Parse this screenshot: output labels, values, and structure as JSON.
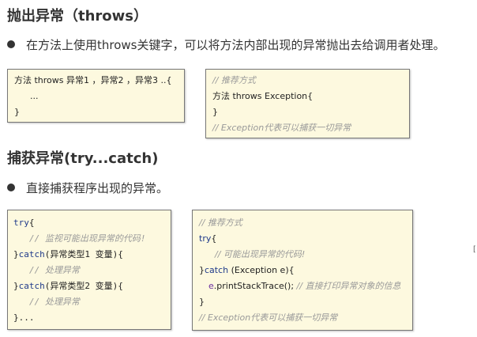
{
  "section1": {
    "title": "抛出异常（throws）",
    "bullet": "在方法上使用throws关键字，可以将方法内部出现的异常抛出去给调用者处理。",
    "box_left": [
      "方法 throws 异常1 ，异常2 ，异常3 ..{",
      "...",
      "}"
    ],
    "box_right": {
      "comment1": "// 推荐方式",
      "line1": "方法 throws Exception{",
      "line2": "}",
      "comment2": "// Exception代表可以捕获一切异常"
    }
  },
  "section2": {
    "title": "捕获异常(try...catch)",
    "bullet": "直接捕获程序出现的异常。",
    "box_left": {
      "try": "try",
      "brace": "{",
      "c1": "// 监视可能出现异常的代码!",
      "close": "}",
      "catch": "catch",
      "catch1_rest": "(异常类型1 变量){",
      "c2": "// 处理异常",
      "catch2_rest": "(异常类型2 变量){",
      "c3": "// 处理异常",
      "end": "}..."
    },
    "box_right": {
      "c0": "// 推荐方式",
      "try": "try",
      "brace": "{",
      "c1": "// 可能出现异常的代码!",
      "close": "}",
      "catch": "catch",
      "catch_rest": " (Exception e){",
      "e": "e",
      "print": ".printStackTrace(); ",
      "c2": "// 直接打印异常对象的信息",
      "end": "}",
      "c3": "// Exception代表可以捕获一切异常"
    }
  },
  "edge_mark": "["
}
